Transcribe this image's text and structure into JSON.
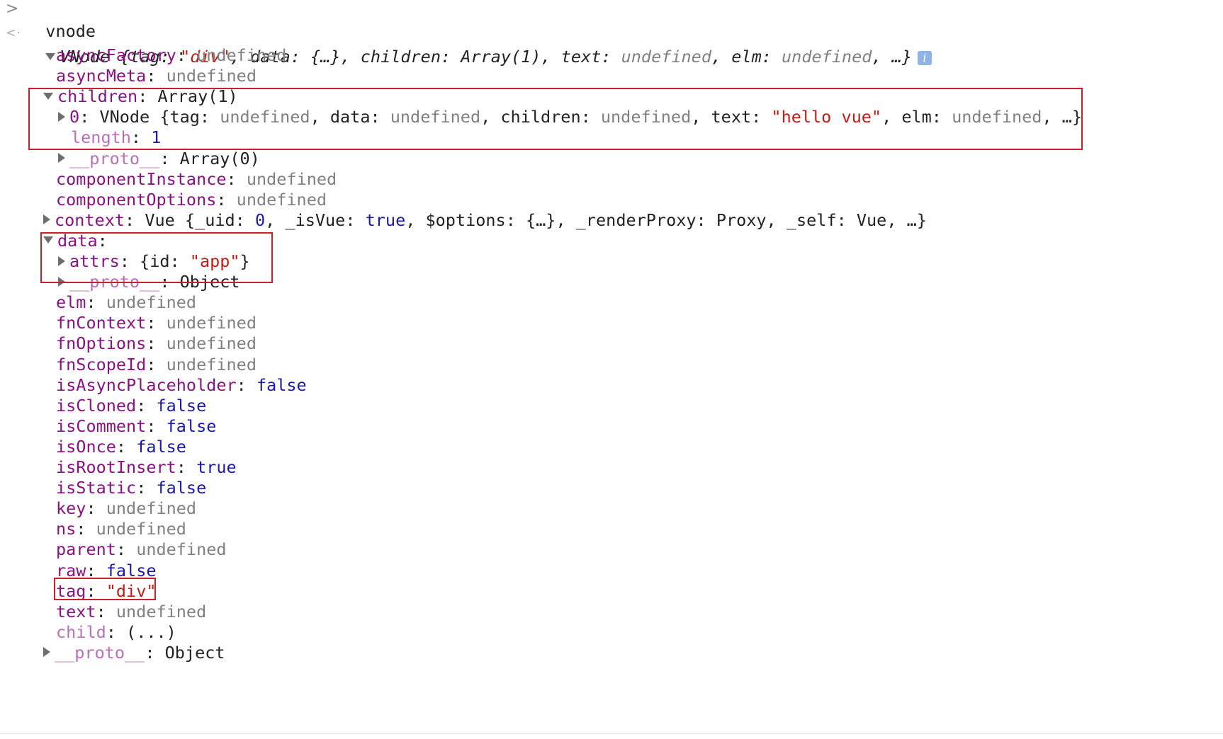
{
  "prompt": {
    "input_glyph": ">",
    "output_glyph": "<·",
    "command": "vnode"
  },
  "summary": {
    "type": "VNode",
    "text": "{tag: \"div\", data: {…}, children: Array(1), text: undefined, elm: undefined, …}",
    "parts": [
      {
        "t": "{",
        "c": "p"
      },
      {
        "t": "tag",
        "c": "p"
      },
      {
        "t": ": ",
        "c": "p"
      },
      {
        "t": "\"div\"",
        "c": "s"
      },
      {
        "t": ", data: {…}, children: Array(1), text: ",
        "c": "p"
      },
      {
        "t": "undefined",
        "c": "u"
      },
      {
        "t": ", elm: ",
        "c": "p"
      },
      {
        "t": "undefined",
        "c": "u"
      },
      {
        "t": ", …}",
        "c": "p"
      }
    ],
    "info_icon": "i"
  },
  "rows": [
    {
      "key": "asyncFactory",
      "val": "undefined",
      "vc": "u"
    },
    {
      "key": "asyncMeta",
      "val": "undefined",
      "vc": "u"
    },
    {
      "key": "children",
      "val": "Array(1)",
      "vc": "p",
      "expanded": true
    },
    {
      "key": "0",
      "val": "VNode {tag: undefined, data: undefined, children: undefined, text: \"hello vue\", elm: undefined, …}",
      "vc": "p",
      "depth": 1,
      "collapsed": true
    },
    {
      "key": "length",
      "val": "1",
      "vc": "b",
      "depth": 1,
      "dim": true
    },
    {
      "key": "__proto__",
      "val": "Array(0)",
      "vc": "p",
      "depth": 1,
      "collapsed": true,
      "dim": true
    },
    {
      "key": "componentInstance",
      "val": "undefined",
      "vc": "u"
    },
    {
      "key": "componentOptions",
      "val": "undefined",
      "vc": "u"
    },
    {
      "key": "context",
      "val": "Vue {_uid: 0, _isVue: true, $options: {…}, _renderProxy: Proxy, _self: Vue, …}",
      "vc": "p",
      "collapsed": true
    },
    {
      "key": "data",
      "val": "",
      "vc": "p",
      "expanded": true
    },
    {
      "key": "attrs",
      "val": "{id: \"app\"}",
      "vc": "p",
      "depth": 1,
      "collapsed": true
    },
    {
      "key": "__proto__",
      "val": "Object",
      "vc": "p",
      "depth": 1,
      "collapsed": true,
      "dim": true
    },
    {
      "key": "elm",
      "val": "undefined",
      "vc": "u"
    },
    {
      "key": "fnContext",
      "val": "undefined",
      "vc": "u"
    },
    {
      "key": "fnOptions",
      "val": "undefined",
      "vc": "u"
    },
    {
      "key": "fnScopeId",
      "val": "undefined",
      "vc": "u"
    },
    {
      "key": "isAsyncPlaceholder",
      "val": "false",
      "vc": "b"
    },
    {
      "key": "isCloned",
      "val": "false",
      "vc": "b"
    },
    {
      "key": "isComment",
      "val": "false",
      "vc": "b"
    },
    {
      "key": "isOnce",
      "val": "false",
      "vc": "b"
    },
    {
      "key": "isRootInsert",
      "val": "true",
      "vc": "b"
    },
    {
      "key": "isStatic",
      "val": "false",
      "vc": "b"
    },
    {
      "key": "key",
      "val": "undefined",
      "vc": "u"
    },
    {
      "key": "ns",
      "val": "undefined",
      "vc": "u"
    },
    {
      "key": "parent",
      "val": "undefined",
      "vc": "u"
    },
    {
      "key": "raw",
      "val": "false",
      "vc": "b"
    },
    {
      "key": "tag",
      "val": "\"div\"",
      "vc": "s"
    },
    {
      "key": "text",
      "val": "undefined",
      "vc": "u"
    },
    {
      "key": "child",
      "val": "(...)",
      "vc": "p",
      "dim": true
    },
    {
      "key": "__proto__",
      "val": "Object",
      "vc": "p",
      "collapsed": true,
      "dim": true
    }
  ],
  "colors": {
    "key": "#881280",
    "key_dim": "#b871b4",
    "undefined": "#808080",
    "keyword": "#1a1aa6",
    "string": "#c41a16",
    "highlight_box": "#c9212a"
  }
}
